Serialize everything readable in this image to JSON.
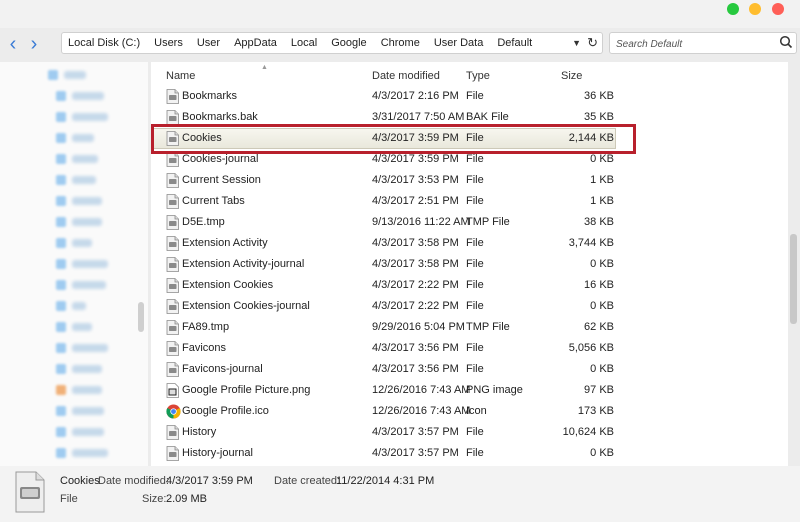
{
  "window": {
    "traffic_lights": [
      "green",
      "yellow",
      "red"
    ]
  },
  "toolbar": {
    "back_glyph": "‹",
    "forward_glyph": "›",
    "breadcrumbs": [
      "Local Disk (C:)",
      "Users",
      "User",
      "AppData",
      "Local",
      "Google",
      "Chrome",
      "User Data",
      "Default"
    ],
    "search_placeholder": "Search Default"
  },
  "columns": {
    "name": "Name",
    "date": "Date modified",
    "type": "Type",
    "size": "Size"
  },
  "files": [
    {
      "name": "Bookmarks",
      "date": "4/3/2017 2:16 PM",
      "type": "File",
      "size": "36 KB",
      "icon": "file-icon"
    },
    {
      "name": "Bookmarks.bak",
      "date": "3/31/2017 7:50 AM",
      "type": "BAK File",
      "size": "35 KB",
      "icon": "file-icon"
    },
    {
      "name": "Cookies",
      "date": "4/3/2017 3:59 PM",
      "type": "File",
      "size": "2,144 KB",
      "icon": "file-icon",
      "selected": true
    },
    {
      "name": "Cookies-journal",
      "date": "4/3/2017 3:59 PM",
      "type": "File",
      "size": "0 KB",
      "icon": "file-icon"
    },
    {
      "name": "Current Session",
      "date": "4/3/2017 3:53 PM",
      "type": "File",
      "size": "1 KB",
      "icon": "file-icon"
    },
    {
      "name": "Current Tabs",
      "date": "4/3/2017 2:51 PM",
      "type": "File",
      "size": "1 KB",
      "icon": "file-icon"
    },
    {
      "name": "D5E.tmp",
      "date": "9/13/2016 11:22 AM",
      "type": "TMP File",
      "size": "38 KB",
      "icon": "file-icon"
    },
    {
      "name": "Extension Activity",
      "date": "4/3/2017 3:58 PM",
      "type": "File",
      "size": "3,744 KB",
      "icon": "file-icon"
    },
    {
      "name": "Extension Activity-journal",
      "date": "4/3/2017 3:58 PM",
      "type": "File",
      "size": "0 KB",
      "icon": "file-icon"
    },
    {
      "name": "Extension Cookies",
      "date": "4/3/2017 2:22 PM",
      "type": "File",
      "size": "16 KB",
      "icon": "file-icon"
    },
    {
      "name": "Extension Cookies-journal",
      "date": "4/3/2017 2:22 PM",
      "type": "File",
      "size": "0 KB",
      "icon": "file-icon"
    },
    {
      "name": "FA89.tmp",
      "date": "9/29/2016 5:04 PM",
      "type": "TMP File",
      "size": "62 KB",
      "icon": "file-icon"
    },
    {
      "name": "Favicons",
      "date": "4/3/2017 3:56 PM",
      "type": "File",
      "size": "5,056 KB",
      "icon": "file-icon"
    },
    {
      "name": "Favicons-journal",
      "date": "4/3/2017 3:56 PM",
      "type": "File",
      "size": "0 KB",
      "icon": "file-icon"
    },
    {
      "name": "Google Profile Picture.png",
      "date": "12/26/2016 7:43 AM",
      "type": "PNG image",
      "size": "97 KB",
      "icon": "image-file-icon"
    },
    {
      "name": "Google Profile.ico",
      "date": "12/26/2016 7:43 AM",
      "type": "Icon",
      "size": "173 KB",
      "icon": "chrome-icon"
    },
    {
      "name": "History",
      "date": "4/3/2017 3:57 PM",
      "type": "File",
      "size": "10,624 KB",
      "icon": "file-icon"
    },
    {
      "name": "History-journal",
      "date": "4/3/2017 3:57 PM",
      "type": "File",
      "size": "0 KB",
      "icon": "file-icon"
    }
  ],
  "details": {
    "name": "Cookies",
    "kind": "File",
    "date_modified_label": "Date modified:",
    "date_modified": "4/3/2017 3:59 PM",
    "date_created_label": "Date created:",
    "date_created": "11/22/2014 4:31 PM",
    "size_label": "Size:",
    "size": "2.09 MB"
  },
  "colors": {
    "accent": "#3a7bd5",
    "highlight_border": "#b8202c"
  }
}
